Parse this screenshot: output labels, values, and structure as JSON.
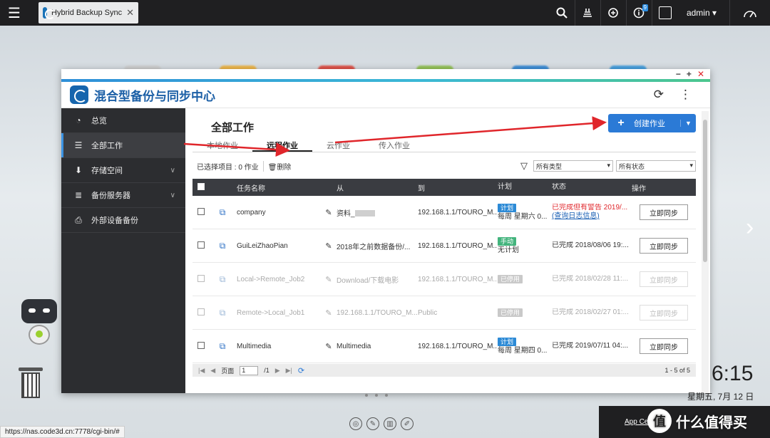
{
  "topbar": {
    "tab_title": "Hybrid Backup Sync",
    "notification_count": "9",
    "user_name": "admin ▾"
  },
  "app": {
    "title": "混合型备份与同步中心"
  },
  "sidebar": {
    "items": [
      {
        "label": "总览",
        "icon": "gauge-icon"
      },
      {
        "label": "全部工作",
        "icon": "list-icon"
      },
      {
        "label": "存储空间",
        "icon": "download-box-icon"
      },
      {
        "label": "备份服务器",
        "icon": "server-icon"
      },
      {
        "label": "外部设备备份",
        "icon": "external-device-icon"
      }
    ]
  },
  "main": {
    "page_title": "全部工作",
    "create_button": "创建作业",
    "tabs": [
      "本地作业",
      "远程作业",
      "云作业",
      "传入作业"
    ],
    "active_tab": "远程作业",
    "selected_info": "已选择项目 : 0 作业",
    "delete_label": "删除",
    "filter_type": "所有类型",
    "filter_status": "所有状态"
  },
  "table": {
    "headers": {
      "name": "任务名称",
      "from": "从",
      "to": "到",
      "plan": "计划",
      "status": "状态",
      "op": "操作"
    },
    "rows": [
      {
        "name": "company",
        "from": "资料_",
        "to": "192.168.1.1/TOURO_M...",
        "plan_tag": "计划",
        "plan_detail": "每周 星期六 0...",
        "status": "已完成但有警告 2019/...",
        "status_link": "(查询日志信息)",
        "action": "立即同步"
      },
      {
        "name": "GuiLeiZhaoPian",
        "from": "2018年之前数据备份/...",
        "to": "192.168.1.1/TOURO_M...",
        "plan_tag": "手动",
        "plan_detail": "无计划",
        "status": "已完成 2018/08/06 19:...",
        "status_link": "",
        "action": "立即同步"
      },
      {
        "name": "Local->Remote_Job2",
        "from": "Download/下载电影",
        "to": "192.168.1.1/TOURO_M...",
        "plan_tag": "已停用",
        "plan_detail": "",
        "status": "已完成 2018/02/28 11:...",
        "status_link": "",
        "action": "立即同步"
      },
      {
        "name": "Remote->Local_Job1",
        "from": "192.168.1.1/TOURO_M...",
        "to": "Public",
        "plan_tag": "已停用",
        "plan_detail": "",
        "status": "已完成 2018/02/27 01:...",
        "status_link": "",
        "action": "立即同步"
      },
      {
        "name": "Multimedia",
        "from": "Multimedia",
        "to": "192.168.1.1/TOURO_M...",
        "plan_tag": "计划",
        "plan_detail": "每周 星期四 0...",
        "status": "已完成 2019/07/11 04:...",
        "status_link": "",
        "action": "立即同步"
      }
    ]
  },
  "pager": {
    "page_label": "页面",
    "page_value": "1",
    "total_pages": "/1",
    "count": "1 - 5 of 5"
  },
  "desktop": {
    "time": "6:15",
    "date": "星期五, 7月 12 日",
    "status_url": "https://nas.code3d.cn:7778/cgi-bin/#",
    "app_center_label": "App Cen",
    "watermark": "什么值得买",
    "watermark_logo": "值"
  },
  "colors": {
    "accent": "#2b7ad6",
    "annotation_arrow": "#e0262b",
    "sidebar_bg": "#2c2d30",
    "warning": "#e0262b"
  }
}
